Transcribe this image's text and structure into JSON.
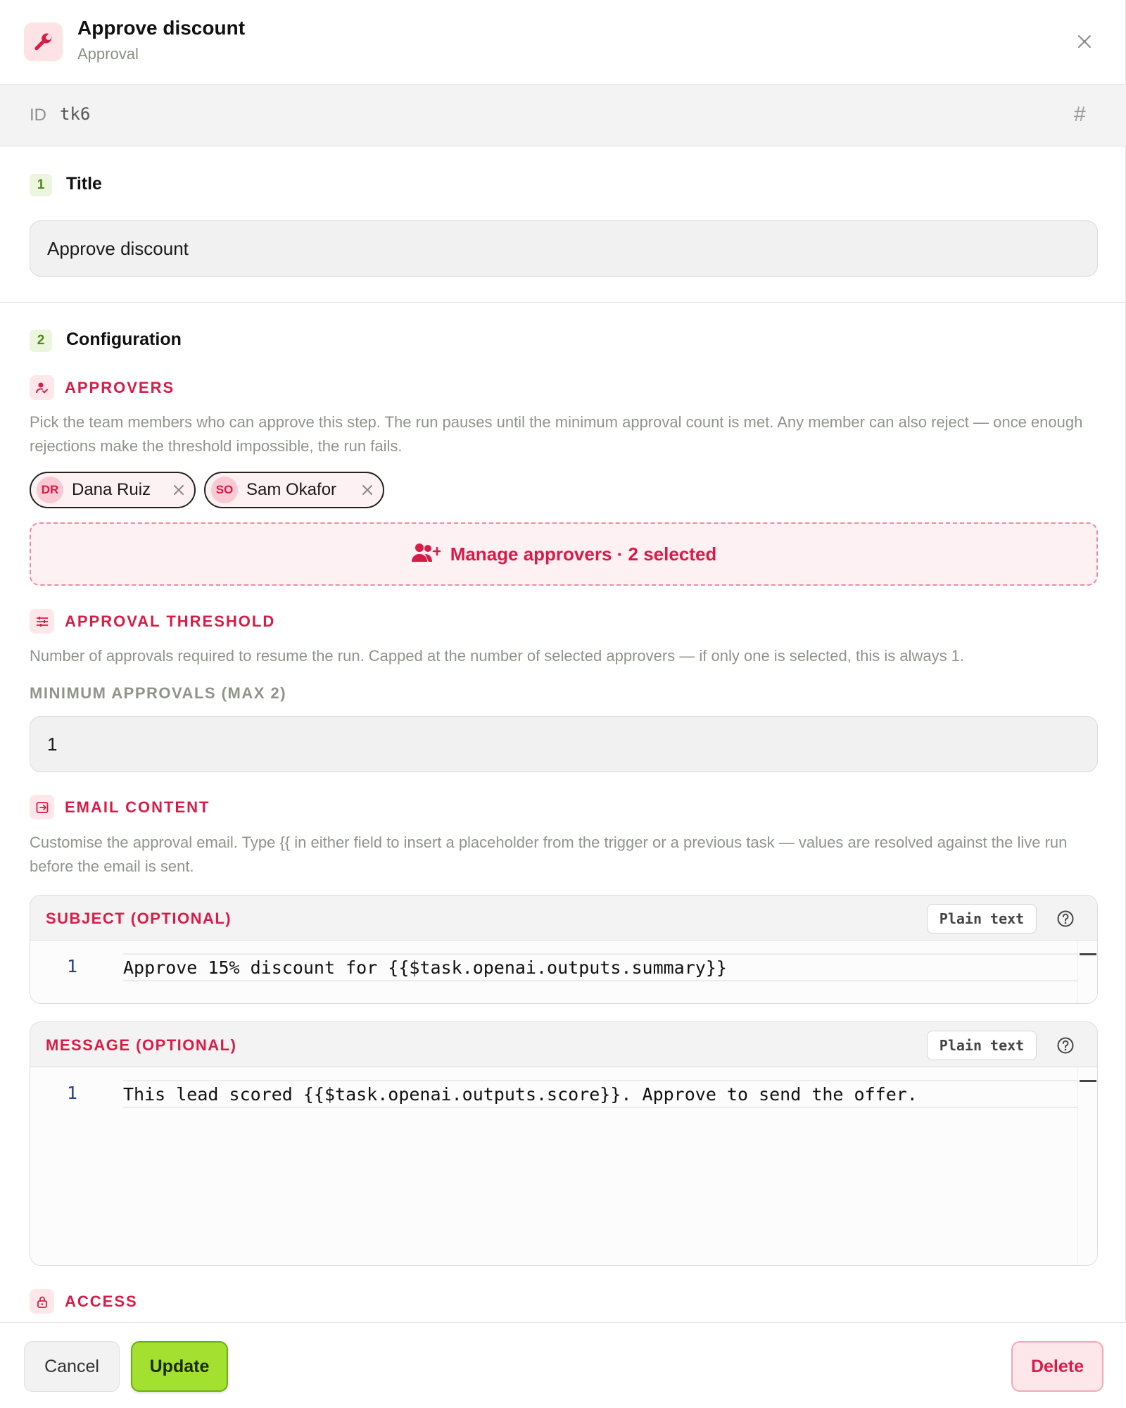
{
  "header": {
    "title": "Approve discount",
    "subtitle": "Approval",
    "icon": "wrench-icon",
    "accent": "#d81b47"
  },
  "idbar": {
    "label": "ID",
    "value": "tk6",
    "copy_icon": "#"
  },
  "sections": {
    "title": {
      "number": "1",
      "heading": "Title",
      "value": "Approve discount"
    },
    "configuration": {
      "number": "2",
      "heading": "Configuration"
    }
  },
  "approvers": {
    "heading": "APPROVERS",
    "description": "Pick the team members who can approve this step. The run pauses until the minimum approval count is met. Any member can also reject — once enough rejections make the threshold impossible, the run fails.",
    "chips": [
      {
        "initials": "DR",
        "name": "Dana Ruiz"
      },
      {
        "initials": "SO",
        "name": "Sam Okafor"
      }
    ],
    "manage_label": "Manage approvers · 2 selected"
  },
  "threshold": {
    "heading": "APPROVAL THRESHOLD",
    "description": "Number of approvals required to resume the run. Capped at the number of selected approvers — if only one is selected, this is always 1.",
    "field_label": "MINIMUM APPROVALS (MAX 2)",
    "value": "1"
  },
  "email": {
    "heading": "EMAIL CONTENT",
    "description": "Customise the approval email. Type {{ in either field to insert a placeholder from the trigger or a previous task — values are resolved against the live run before the email is sent.",
    "subject": {
      "label": "SUBJECT (OPTIONAL)",
      "mode": "Plain text",
      "line_number": "1",
      "code": "Approve 15% discount for {{$task.openai.outputs.summary}}"
    },
    "message": {
      "label": "MESSAGE (OPTIONAL)",
      "mode": "Plain text",
      "line_number": "1",
      "code": "This lead scored {{$task.openai.outputs.score}}. Approve to send the offer."
    }
  },
  "access": {
    "heading": "ACCESS"
  },
  "footer": {
    "cancel": "Cancel",
    "update": "Update",
    "delete": "Delete"
  }
}
